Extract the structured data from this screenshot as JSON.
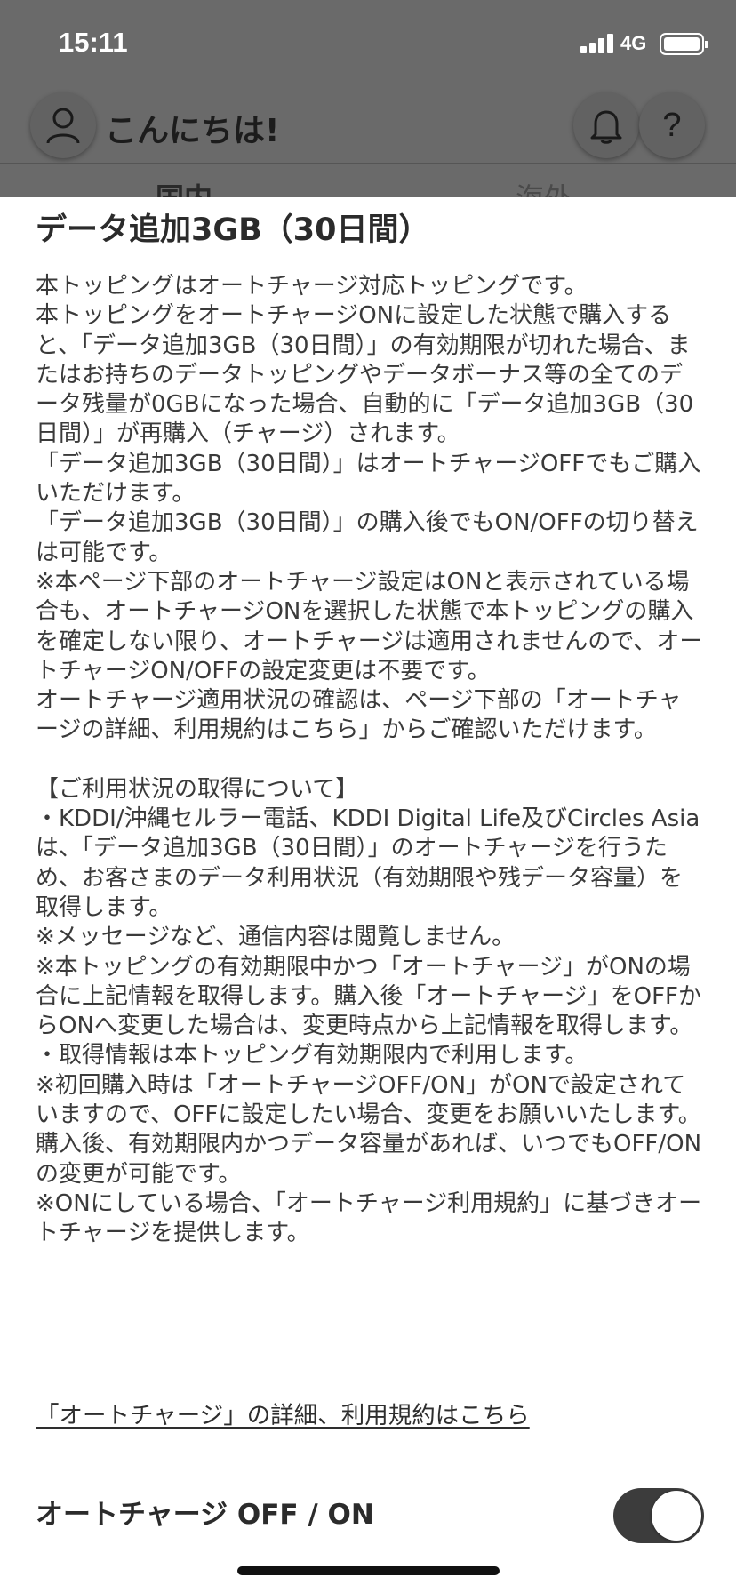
{
  "status_bar": {
    "time": "15:11",
    "network": "4G"
  },
  "header": {
    "greeting": "こんにちは!",
    "help_glyph": "?"
  },
  "tabs": [
    {
      "label": "国内"
    },
    {
      "label": "海外"
    }
  ],
  "sheet": {
    "title": "データ追加3GB（30日間）",
    "paragraphs": [
      "本トッピングはオートチャージ対応トッピングです。\n本トッピングをオートチャージONに設定した状態で購入すると、「データ追加3GB（30日間）」の有効期限が切れた場合、またはお持ちのデータトッピングやデータボーナス等の全てのデータ残量が0GBになった場合、自動的に「データ追加3GB（30日間）」が再購入（チャージ）されます。\n「データ追加3GB（30日間）」はオートチャージOFFでもご購入いただけます。\n「データ追加3GB（30日間）」の購入後でもON/OFFの切り替えは可能です。\n※本ページ下部のオートチャージ設定はONと表示されている場合も、オートチャージONを選択した状態で本トッピングの購入を確定しない限り、オートチャージは適用されませんので、オートチャージON/OFFの設定変更は不要です。\nオートチャージ適用状況の確認は、ページ下部の「オートチャージの詳細、利用規約はこちら」からご確認いただけます。",
      "【ご利用状況の取得について】\n・KDDI/沖縄セルラー電話、KDDI Digital Life及びCircles Asiaは、「データ追加3GB（30日間）」のオートチャージを行うため、お客さまのデータ利用状況（有効期限や残データ容量）を取得します。\n※メッセージなど、通信内容は閲覧しません。\n※本トッピングの有効期限中かつ「オートチャージ」がONの場合に上記情報を取得します。購入後「オートチャージ」をOFFからONへ変更した場合は、変更時点から上記情報を取得します。\n・取得情報は本トッピング有効期限内で利用します。\n※初回購入時は「オートチャージOFF/ON」がONで設定されていますので、OFFに設定したい場合、変更をお願いいたします。\n購入後、有効期限内かつデータ容量があれば、いつでもOFF/ONの変更が可能です。\n※ONにしている場合、「オートチャージ利用規約」に基づきオートチャージを提供します。"
    ],
    "detail_link": "「オートチャージ」の詳細、利用規約はこちら",
    "autocharge_label": "オートチャージ OFF / ON",
    "autocharge_on": true
  },
  "colors": {
    "toggle_on": "#3c3c3c",
    "overlay": "#6a6a6a"
  }
}
